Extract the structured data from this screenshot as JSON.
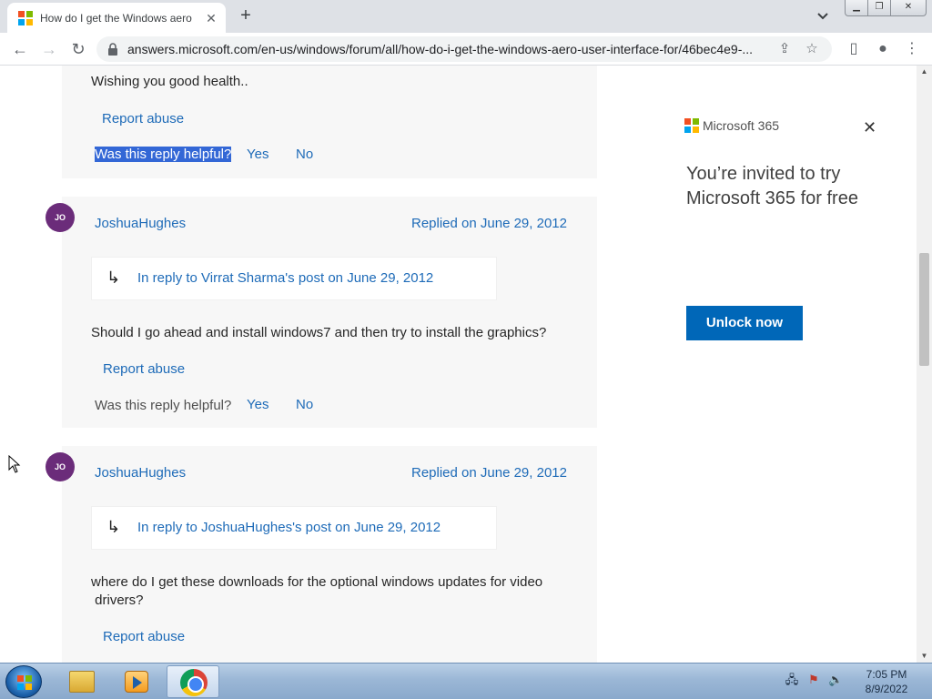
{
  "browser": {
    "tab_title": "How do I get the Windows aero",
    "url": "answers.microsoft.com/en-us/windows/forum/all/how-do-i-get-the-windows-aero-user-interface-for/46bec4e9-..."
  },
  "first_message": {
    "text": "Wishing you good health..",
    "report": "Report abuse",
    "helpful": "Was this reply helpful?",
    "yes": "Yes",
    "no": "No"
  },
  "replies": [
    {
      "avatar": "JO",
      "author": "JoshuaHughes",
      "date": "Replied on June 29, 2012",
      "in_reply": "In reply to Virrat Sharma's post on June 29, 2012",
      "text": "Should I go ahead  and install windows7 and then try to install the graphics?",
      "report": "Report abuse",
      "helpful": "Was this reply helpful?",
      "yes": "Yes",
      "no": "No"
    },
    {
      "avatar": "JO",
      "author": "JoshuaHughes",
      "date": "Replied on June 29, 2012",
      "in_reply": "In reply to JoshuaHughes's post on June 29, 2012",
      "text_line1": "where do I  get these downloads  for the optional windows updates for video",
      "text_line2": " drivers?",
      "report": "Report abuse"
    }
  ],
  "ad": {
    "brand": "Microsoft 365",
    "headline": "You’re invited to try Microsoft 365 for free",
    "button": "Unlock now"
  },
  "taskbar": {
    "time": "7:05 PM",
    "date": "8/9/2022"
  }
}
